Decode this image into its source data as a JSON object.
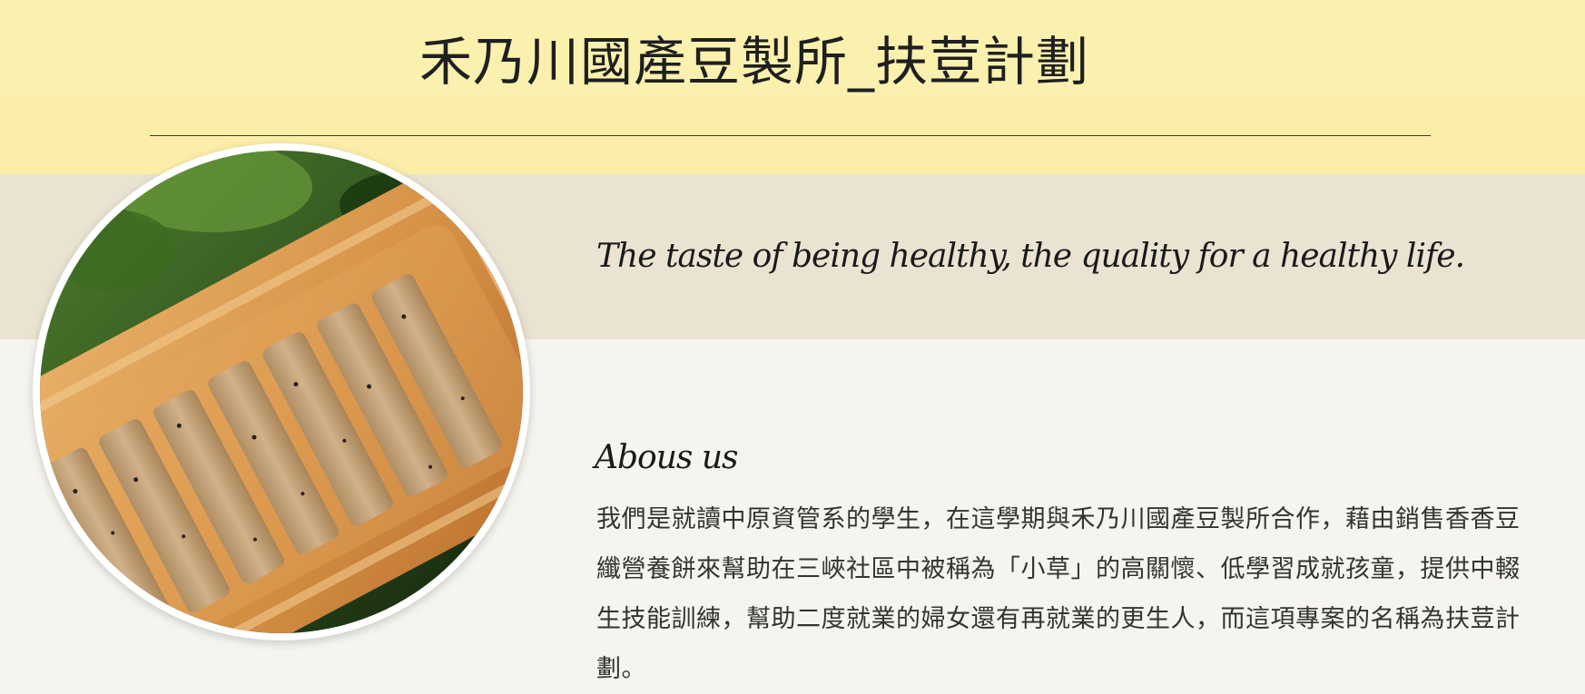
{
  "header": {
    "title": "禾乃川國產豆製所_扶荳計劃"
  },
  "tagline": {
    "text": "The taste of being healthy, the quality for a healthy life."
  },
  "about": {
    "heading": "Abous us",
    "body": "我們是就讀中原資管系的學生，在這學期與禾乃川國產豆製所合作，藉由銷售香香豆纖營養餅來幫助在三峽社區中被稱為「小草」的高關懷、低學習成就孩童，提供中輟生技能訓練，幫助二度就業的婦女還有再就業的更生人，而這項專案的名稱為扶荳計劃。"
  },
  "photo": {
    "subject": "soy fiber biscuit sticks on wooden tray",
    "colors": {
      "tray": "#d99a52",
      "biscuit": "#c9a77e",
      "foliage": "#2f5a24"
    }
  }
}
